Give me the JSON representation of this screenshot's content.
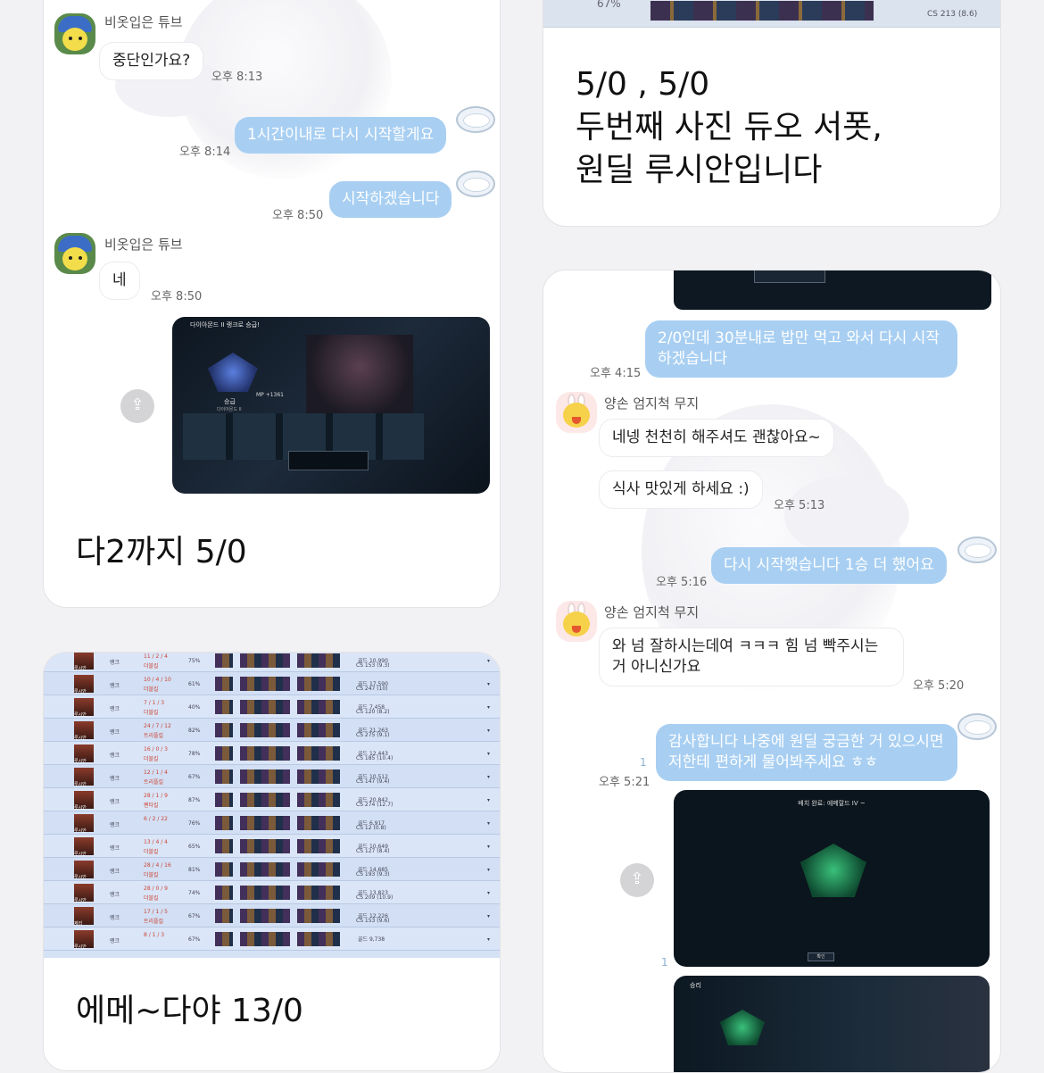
{
  "card1": {
    "msg1": {
      "sender": "비옷입은 튜브",
      "text": "중단인가요?",
      "time": "오후 8:13"
    },
    "msg2": {
      "text": "1시간이내로 다시 시작할게요",
      "time": "오후 8:14"
    },
    "msg3": {
      "text": "시작하겠습니다",
      "time": "오후 8:50"
    },
    "msg4": {
      "sender": "비옷입은 튜브",
      "text": "네",
      "time": "오후 8:50"
    },
    "shot": {
      "banner": "다이아몬드 II 랭크로 승급!",
      "rank": "승급",
      "rank_sub": "다이아몬드 II",
      "lp": "MP +1361",
      "share_icon": "share-icon"
    },
    "caption": "다2까지 5/0"
  },
  "card2": {
    "top_strip": {
      "percent": "67%",
      "cs": "CS 213 (8.6)"
    },
    "caption_lines": [
      "5/0 , 5/0",
      "두번째 사진 듀오 서폿,",
      "원딜 루시안입니다"
    ]
  },
  "card3": {
    "msg1": {
      "text": "2/0인데 30분내로 밥만 먹고 와서 다시 시작하겠습니다",
      "time": "오후 4:15"
    },
    "msg2": {
      "sender": "양손 엄지척 무지",
      "text": "네넹 천천히 해주셔도 괜찮아요~"
    },
    "msg3": {
      "text": "식사 맛있게 하세요 :)",
      "time": "오후 5:13"
    },
    "msg4": {
      "text": "다시 시작햇습니다 1승 더 했어요",
      "time": "오후 5:16"
    },
    "msg5": {
      "sender": "양손 엄지척 무지",
      "text": "와 넘 잘하시는데여 ㅋㅋㅋ 힘 넘 빡주시는 거 아니신가요",
      "time": "오후 5:20"
    },
    "msg6": {
      "text": "감사합니다 나중에 원딜 궁금한 거 있으시면 저한테 편하게 물어봐주세요 ㅎㅎ",
      "time": "오후 5:21",
      "unread": "1"
    },
    "shot1": {
      "title": "배치 완료: 에메랄드 IV ~",
      "button": "확인",
      "unread": "1"
    },
    "shot2": {
      "label": "승리"
    }
  },
  "card4": {
    "rows": [
      {
        "champ": "루시안",
        "kda": "11 / 2 / 4",
        "grade": "더블킬",
        "pct": "75%",
        "gold": "골드 10,990",
        "cs": "CS 153 (9.3)"
      },
      {
        "champ": "루시안",
        "kda": "10 / 4 / 10",
        "grade": "더블킬",
        "pct": "61%",
        "gold": "골드 17,590",
        "cs": "CS 247 (10)"
      },
      {
        "champ": "루시안",
        "kda": "7 / 1 / 3",
        "grade": "더블킬",
        "pct": "40%",
        "gold": "골드 7,458",
        "cs": "CS 120 (8.2)"
      },
      {
        "champ": "루시안",
        "kda": "24 / 7 / 12",
        "grade": "트리플킬",
        "pct": "82%",
        "gold": "골드 21,263",
        "cs": "CS 275 (9.1)"
      },
      {
        "champ": "루시안",
        "kda": "16 / 0 / 3",
        "grade": "더블킬",
        "pct": "78%",
        "gold": "골드 12,443",
        "cs": "CS 185 (10.4)"
      },
      {
        "champ": "루시안",
        "kda": "12 / 1 / 4",
        "grade": "트리플킬",
        "pct": "67%",
        "gold": "골드 10,512",
        "cs": "CS 147 (9.4)"
      },
      {
        "champ": "루시안",
        "kda": "28 / 1 / 9",
        "grade": "펜타킬",
        "pct": "87%",
        "gold": "골드 20,842",
        "cs": "CS 274 (12.7)"
      },
      {
        "champ": "루시안",
        "kda": "6 / 2 / 22",
        "grade": "",
        "pct": "76%",
        "gold": "골드 6,917",
        "cs": "CS 12 (0.8)"
      },
      {
        "champ": "루시안",
        "kda": "13 / 4 / 4",
        "grade": "더블킬",
        "pct": "65%",
        "gold": "골드 10,649",
        "cs": "CS 127 (8.4)"
      },
      {
        "champ": "루시안",
        "kda": "28 / 4 / 16",
        "grade": "더블킬",
        "pct": "81%",
        "gold": "골드 14,685",
        "cs": "CS 193 (9.3)"
      },
      {
        "champ": "루시안",
        "kda": "28 / 0 / 9",
        "grade": "더블킬",
        "pct": "74%",
        "gold": "골드 13,823",
        "cs": "CS 209 (10.9)"
      },
      {
        "champ": "제리",
        "kda": "17 / 1 / 5",
        "grade": "트리플킬",
        "pct": "67%",
        "gold": "골드 12,226",
        "cs": "CS 153 (9.6)"
      },
      {
        "champ": "루시안",
        "kda": "8 / 1 / 3",
        "grade": "",
        "pct": "67%",
        "gold": "골드 9,738",
        "cs": ""
      }
    ],
    "caption": "에메~다야 13/0"
  }
}
